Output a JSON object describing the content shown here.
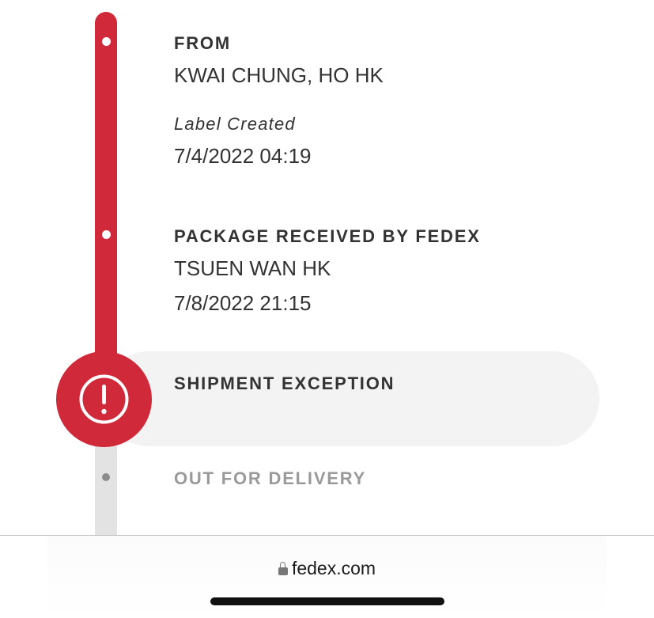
{
  "timeline": {
    "from": {
      "heading": "FROM",
      "location": "KWAI CHUNG, HO HK",
      "status": "Label Created",
      "datetime": "7/4/2022 04:19"
    },
    "received": {
      "heading": "PACKAGE RECEIVED BY FEDEX",
      "location": "TSUEN WAN HK",
      "datetime": "7/8/2022 21:15"
    },
    "exception": {
      "heading": "SHIPMENT EXCEPTION",
      "icon": "exclamation-circle-icon"
    },
    "delivery": {
      "heading": "OUT FOR DELIVERY"
    }
  },
  "browser": {
    "url": "fedex.com",
    "lock_icon": "lock-icon"
  },
  "colors": {
    "accent": "#d0293a",
    "inactive_track": "#e3e3e3",
    "pill_bg": "#f3f3f3",
    "text": "#333333",
    "muted": "#9a9a9a"
  }
}
